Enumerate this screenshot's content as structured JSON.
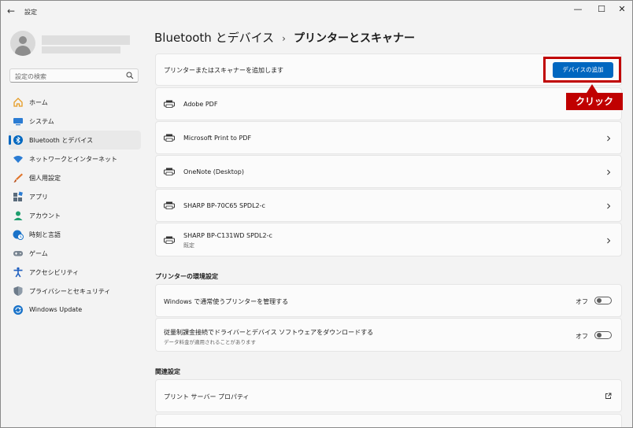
{
  "window": {
    "title": "設定",
    "back": "←",
    "minimize": "—",
    "maximize": "☐",
    "close": "✕"
  },
  "search": {
    "placeholder": "設定の検索"
  },
  "sidebar": {
    "items": [
      {
        "label": "ホーム",
        "icon": "home-icon",
        "color": "#e69c24"
      },
      {
        "label": "システム",
        "icon": "monitor-icon",
        "color": "#2b7cd3"
      },
      {
        "label": "Bluetooth とデバイス",
        "icon": "bluetooth-icon",
        "color": "#0067c0",
        "active": true
      },
      {
        "label": "ネットワークとインターネット",
        "icon": "wifi-icon",
        "color": "#2b7cd3"
      },
      {
        "label": "個人用設定",
        "icon": "brush-icon",
        "color": "#e0742a"
      },
      {
        "label": "アプリ",
        "icon": "apps-icon",
        "color": "#5a6b7b"
      },
      {
        "label": "アカウント",
        "icon": "person-icon",
        "color": "#1f9e6e"
      },
      {
        "label": "時刻と言語",
        "icon": "globe-clock-icon",
        "color": "#1a73c9"
      },
      {
        "label": "ゲーム",
        "icon": "gamepad-icon",
        "color": "#7a8692"
      },
      {
        "label": "アクセシビリティ",
        "icon": "accessibility-icon",
        "color": "#1f5fbf"
      },
      {
        "label": "プライバシーとセキュリティ",
        "icon": "shield-icon",
        "color": "#6d7b8a"
      },
      {
        "label": "Windows Update",
        "icon": "update-icon",
        "color": "#1a73c9"
      }
    ]
  },
  "breadcrumb": {
    "parent": "Bluetooth とデバイス",
    "separator": "›",
    "current": "プリンターとスキャナー"
  },
  "add_card": {
    "label": "プリンターまたはスキャナーを追加します",
    "button": "デバイスの追加"
  },
  "callout": {
    "text": "クリック"
  },
  "printers": [
    {
      "name": "Adobe PDF",
      "status": ""
    },
    {
      "name": "Microsoft Print to PDF",
      "status": ""
    },
    {
      "name": "OneNote (Desktop)",
      "status": ""
    },
    {
      "name": "SHARP BP-70C65 SPDL2-c",
      "status": ""
    },
    {
      "name": "SHARP BP-C131WD SPDL2-c",
      "status": "既定"
    }
  ],
  "prefs": {
    "title": "プリンターの環境設定",
    "items": [
      {
        "label": "Windows で通常使うプリンターを管理する",
        "desc": "",
        "state": "オフ"
      },
      {
        "label": "従量制課金接続でドライバーとデバイス ソフトウェアをダウンロードする",
        "desc": "データ料金が適用されることがあります",
        "state": "オフ"
      }
    ]
  },
  "related": {
    "title": "関連設定",
    "items": [
      {
        "label": "プリント サーバー プロパティ"
      }
    ]
  },
  "colors": {
    "accent": "#0067c0",
    "callout": "#c00000"
  }
}
